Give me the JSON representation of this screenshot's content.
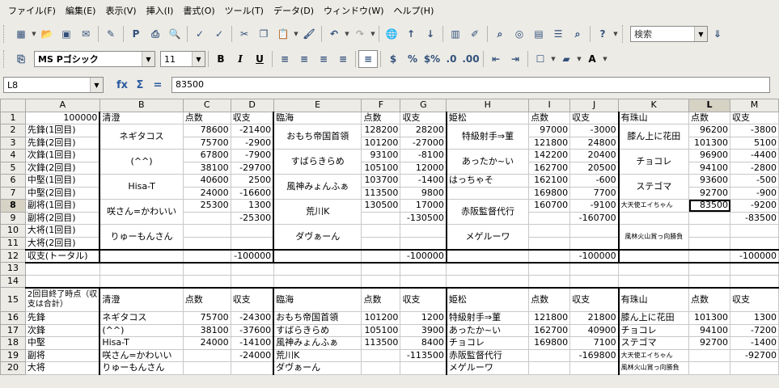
{
  "menu": [
    "ファイル(F)",
    "編集(E)",
    "表示(V)",
    "挿入(I)",
    "書式(O)",
    "ツール(T)",
    "データ(D)",
    "ウィンドウ(W)",
    "ヘルプ(H)"
  ],
  "toolbar": {
    "search_placeholder": "検索"
  },
  "format": {
    "font": "MS Pゴシック",
    "size": "11"
  },
  "formula": {
    "cellref": "L8",
    "value": "83500",
    "fx": "fx",
    "sum": "Σ",
    "eq": "="
  },
  "grid": {
    "cols": [
      "A",
      "B",
      "C",
      "D",
      "E",
      "F",
      "G",
      "H",
      "I",
      "J",
      "K",
      "L",
      "M"
    ],
    "rows": [
      "1",
      "2",
      "3",
      "4",
      "5",
      "6",
      "7",
      "8",
      "9",
      "10",
      "11",
      "12",
      "13",
      "14",
      "15",
      "16",
      "17",
      "18",
      "19",
      "20"
    ],
    "r1": {
      "a": "100000",
      "b": "清澄",
      "c": "点数",
      "d": "収支",
      "e": "臨海",
      "f": "点数",
      "g": "収支",
      "h": "姫松",
      "i": "点数",
      "j": "収支",
      "k": "有珠山",
      "l": "点数",
      "m": "収支"
    },
    "r2": {
      "a": "先鋒(1回目)",
      "c": "78600",
      "d": "-21400",
      "f": "128200",
      "g": "28200",
      "i": "97000",
      "j": "-3000",
      "l": "96200",
      "m": "-3800"
    },
    "r3": {
      "a": "先鋒(2回目)",
      "c": "75700",
      "d": "-2900",
      "f": "101200",
      "g": "-27000",
      "i": "121800",
      "j": "24800",
      "l": "101300",
      "m": "5100"
    },
    "r4": {
      "a": "次鋒(1回目)",
      "c": "67800",
      "d": "-7900",
      "f": "93100",
      "g": "-8100",
      "i": "142200",
      "j": "20400",
      "l": "96900",
      "m": "-4400"
    },
    "r5": {
      "a": "次鋒(2回目)",
      "c": "38100",
      "d": "-29700",
      "f": "105100",
      "g": "12000",
      "i": "162700",
      "j": "20500",
      "l": "94100",
      "m": "-2800"
    },
    "r6": {
      "a": "中堅(1回目)",
      "c": "40600",
      "d": "2500",
      "f": "103700",
      "g": "-1400",
      "h": "はっちゃそ",
      "i": "162100",
      "j": "-600",
      "l": "93600",
      "m": "-500"
    },
    "r7": {
      "a": "中堅(2回目)",
      "c": "24000",
      "d": "-16600",
      "f": "113500",
      "g": "9800",
      "i": "169800",
      "j": "7700",
      "l": "92700",
      "m": "-900"
    },
    "r8": {
      "a": "副将(1回目)",
      "c": "25300",
      "d": "1300",
      "f": "130500",
      "g": "17000",
      "i": "160700",
      "j": "-9100",
      "l": "83500",
      "m": "-9200"
    },
    "r9": {
      "a": "副将(2回目)",
      "d": "-25300",
      "g": "-130500",
      "j": "-160700",
      "m": "-83500"
    },
    "r10": {
      "a": "大将(1回目)"
    },
    "r11": {
      "a": "大将(2回目)"
    },
    "r12": {
      "a": "収支(トータル)",
      "d": "-100000",
      "g": "-100000",
      "j": "-100000",
      "m": "-100000"
    },
    "names": {
      "b23": "ネギタコス",
      "b45": "(^^)",
      "b67": "Hisa-T",
      "b89": "咲さん=かわいい",
      "b1011": "りゅーもんさん",
      "e23": "おもち帝国首領",
      "e45": "すばらきらめ",
      "e67": "風神みょんふぁ",
      "e89": "荒川K",
      "e1011": "ダヴぁーん",
      "h23": "特級射手⇒菫",
      "h45": "あったか~い",
      "h89": "赤阪監督代行",
      "h1011": "メゲルーワ",
      "k23": "膝ん上に花田",
      "k45": "チョコレ",
      "k67": "ステゴマ",
      "k8": "大天使エイちゃん",
      "k1011": "風林火山賞っ向勝負"
    },
    "r15": {
      "a": "2回目終了時点（収支は合計）",
      "b": "清澄",
      "c": "点数",
      "d": "収支",
      "e": "臨海",
      "f": "点数",
      "g": "収支",
      "h": "姫松",
      "i": "点数",
      "j": "収支",
      "k": "有珠山",
      "l": "点数",
      "m": "収支"
    },
    "r16": {
      "a": "先鋒",
      "b": "ネギタコス",
      "c": "75700",
      "d": "-24300",
      "e": "おもち帝国首領",
      "f": "101200",
      "g": "1200",
      "h": "特級射手⇒菫",
      "i": "121800",
      "j": "21800",
      "k": "膝ん上に花田",
      "l": "101300",
      "m": "1300"
    },
    "r17": {
      "a": "次鋒",
      "b": "(^^)",
      "c": "38100",
      "d": "-37600",
      "e": "すばらきらめ",
      "f": "105100",
      "g": "3900",
      "h": "あったか~い",
      "i": "162700",
      "j": "40900",
      "k": "チョコレ",
      "l": "94100",
      "m": "-7200"
    },
    "r18": {
      "a": "中堅",
      "b": "Hisa-T",
      "c": "24000",
      "d": "-14100",
      "e": "風神みょんふぁ",
      "f": "113500",
      "g": "8400",
      "h": "チョコレ",
      "i": "169800",
      "j": "7100",
      "k": "ステゴマ",
      "l": "92700",
      "m": "-1400"
    },
    "r19": {
      "a": "副将",
      "b": "咲さん=かわいい",
      "d": "-24000",
      "e": "荒川K",
      "g": "-113500",
      "h": "赤阪監督代行",
      "j": "-169800",
      "k": "大天使エイちゃん",
      "m": "-92700"
    },
    "r20": {
      "a": "大将",
      "b": "りゅーもんさん",
      "e": "ダヴぁーん",
      "h": "メゲルーワ",
      "k": "風林火山賞っ向勝負"
    }
  }
}
